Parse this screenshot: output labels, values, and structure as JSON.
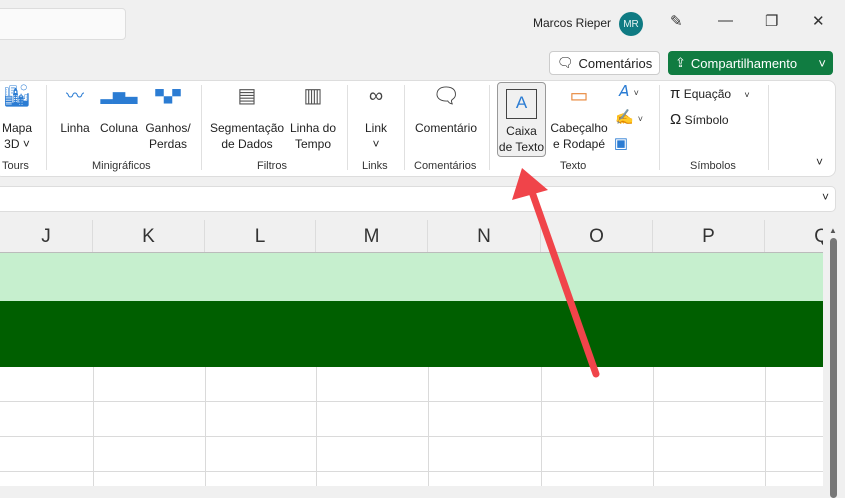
{
  "titlebar": {
    "user_name": "Marcos Rieper",
    "avatar_initials": "MR"
  },
  "actions": {
    "comments": "Comentários",
    "share": "Compartilhamento"
  },
  "ribbon": {
    "groups": [
      {
        "label": "Tours",
        "items": [
          {
            "label": "Mapa 3D ˅"
          }
        ]
      },
      {
        "label": "Minigráficos",
        "items": [
          {
            "label": "Linha"
          },
          {
            "label": "Coluna"
          },
          {
            "label": "Ganhos/ Perdas"
          }
        ]
      },
      {
        "label": "Filtros",
        "items": [
          {
            "label": "Segmentação de Dados"
          },
          {
            "label": "Linha do Tempo"
          }
        ]
      },
      {
        "label": "Links",
        "items": [
          {
            "label": "Link ˅"
          }
        ]
      },
      {
        "label": "Comentários",
        "items": [
          {
            "label": "Comentário"
          }
        ]
      },
      {
        "label": "Texto",
        "items": [
          {
            "label": "Caixa de Texto"
          },
          {
            "label": "Cabeçalho e Rodapé"
          }
        ]
      },
      {
        "label": "Símbolos",
        "items": [
          {
            "label": "Equação"
          },
          {
            "label": "Símbolo"
          }
        ]
      }
    ]
  },
  "columns": [
    "J",
    "K",
    "L",
    "M",
    "N",
    "O",
    "P",
    "Q"
  ],
  "colors": {
    "accent": "#107c41",
    "light_row": "#c6efce",
    "dark_row": "#005f00",
    "arrow": "#f0444a"
  }
}
